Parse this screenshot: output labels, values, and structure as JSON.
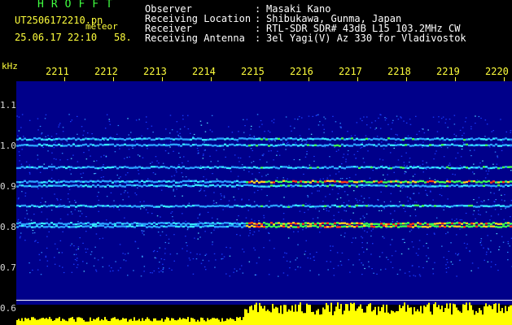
{
  "header": {
    "logo": "HROFFT",
    "filename": "UT2506172210.pn",
    "meteor_label": "meteor",
    "datetime": "25.06.17 22:10",
    "count": "58.",
    "fields": [
      {
        "label": "Observer",
        "value": "Masaki Kano"
      },
      {
        "label": "Receiving Location",
        "value": "Shibukawa, Gunma, Japan"
      },
      {
        "label": "Receiver",
        "value": "RTL-SDR SDR# 43dB L15 103.2MHz CW"
      },
      {
        "label": "Receiving Antenna",
        "value": "3el Yagi(V) Az 330 for Vladivostok"
      }
    ],
    "separator": ":"
  },
  "axis": {
    "y_unit": "kHz",
    "y_ticks": [
      "1.1",
      "1.0",
      "0.9",
      "0.8",
      "0.7",
      "0.6"
    ],
    "x_ticks": [
      "2211",
      "2212",
      "2213",
      "2214",
      "2215",
      "2216",
      "2217",
      "2218",
      "2219",
      "2220"
    ]
  },
  "spectrogram": {
    "background_color": "#00008a",
    "power_color": "#ffff00",
    "bands_khz": [
      1.02,
      1.005,
      0.95,
      0.915,
      0.905,
      0.855,
      0.812,
      0.805
    ]
  }
}
